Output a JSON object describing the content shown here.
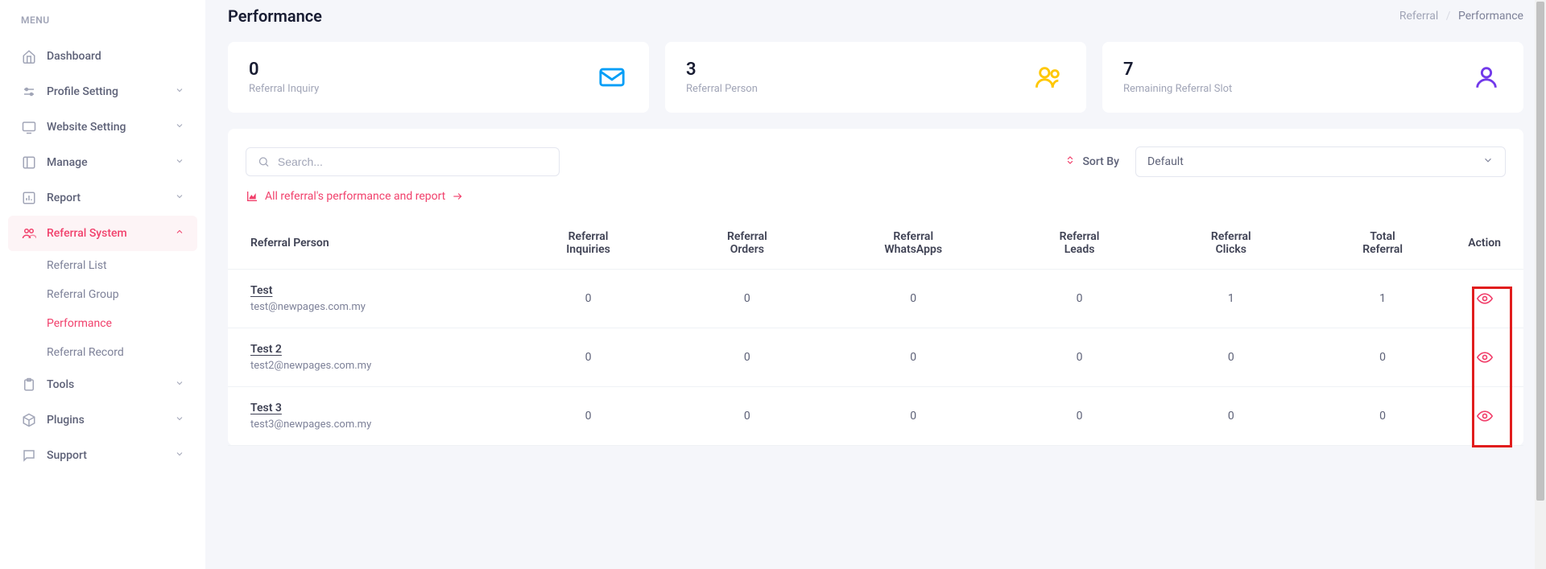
{
  "sidebar": {
    "menu_header": "MENU",
    "items": [
      {
        "label": "Dashboard",
        "expandable": false
      },
      {
        "label": "Profile Setting",
        "expandable": true
      },
      {
        "label": "Website Setting",
        "expandable": true
      },
      {
        "label": "Manage",
        "expandable": true
      },
      {
        "label": "Report",
        "expandable": true
      },
      {
        "label": "Referral System",
        "expandable": true,
        "active": true
      },
      {
        "label": "Tools",
        "expandable": true
      },
      {
        "label": "Plugins",
        "expandable": true
      },
      {
        "label": "Support",
        "expandable": true
      }
    ],
    "referral_sub": [
      {
        "label": "Referral List"
      },
      {
        "label": "Referral Group"
      },
      {
        "label": "Performance",
        "active": true
      },
      {
        "label": "Referral Record"
      }
    ]
  },
  "page": {
    "title": "Performance",
    "breadcrumb_root": "Referral",
    "breadcrumb_current": "Performance"
  },
  "stats": [
    {
      "value": "0",
      "label": "Referral Inquiry"
    },
    {
      "value": "3",
      "label": "Referral Person"
    },
    {
      "value": "7",
      "label": "Remaining Referral Slot"
    }
  ],
  "toolbar": {
    "search_placeholder": "Search...",
    "sort_label": "Sort By",
    "sort_value": "Default"
  },
  "report_link": "All referral's performance and report",
  "table": {
    "headers": [
      "Referral Person",
      "Referral Inquiries",
      "Referral Orders",
      "Referral WhatsApps",
      "Referral Leads",
      "Referral Clicks",
      "Total Referral",
      "Action"
    ],
    "rows": [
      {
        "name": "Test",
        "email": "test@newpages.com.my",
        "inquiries": "0",
        "orders": "0",
        "whatsapps": "0",
        "leads": "0",
        "clicks": "1",
        "total": "1"
      },
      {
        "name": "Test 2",
        "email": "test2@newpages.com.my",
        "inquiries": "0",
        "orders": "0",
        "whatsapps": "0",
        "leads": "0",
        "clicks": "0",
        "total": "0"
      },
      {
        "name": "Test 3",
        "email": "test3@newpages.com.my",
        "inquiries": "0",
        "orders": "0",
        "whatsapps": "0",
        "leads": "0",
        "clicks": "0",
        "total": "0"
      }
    ]
  }
}
